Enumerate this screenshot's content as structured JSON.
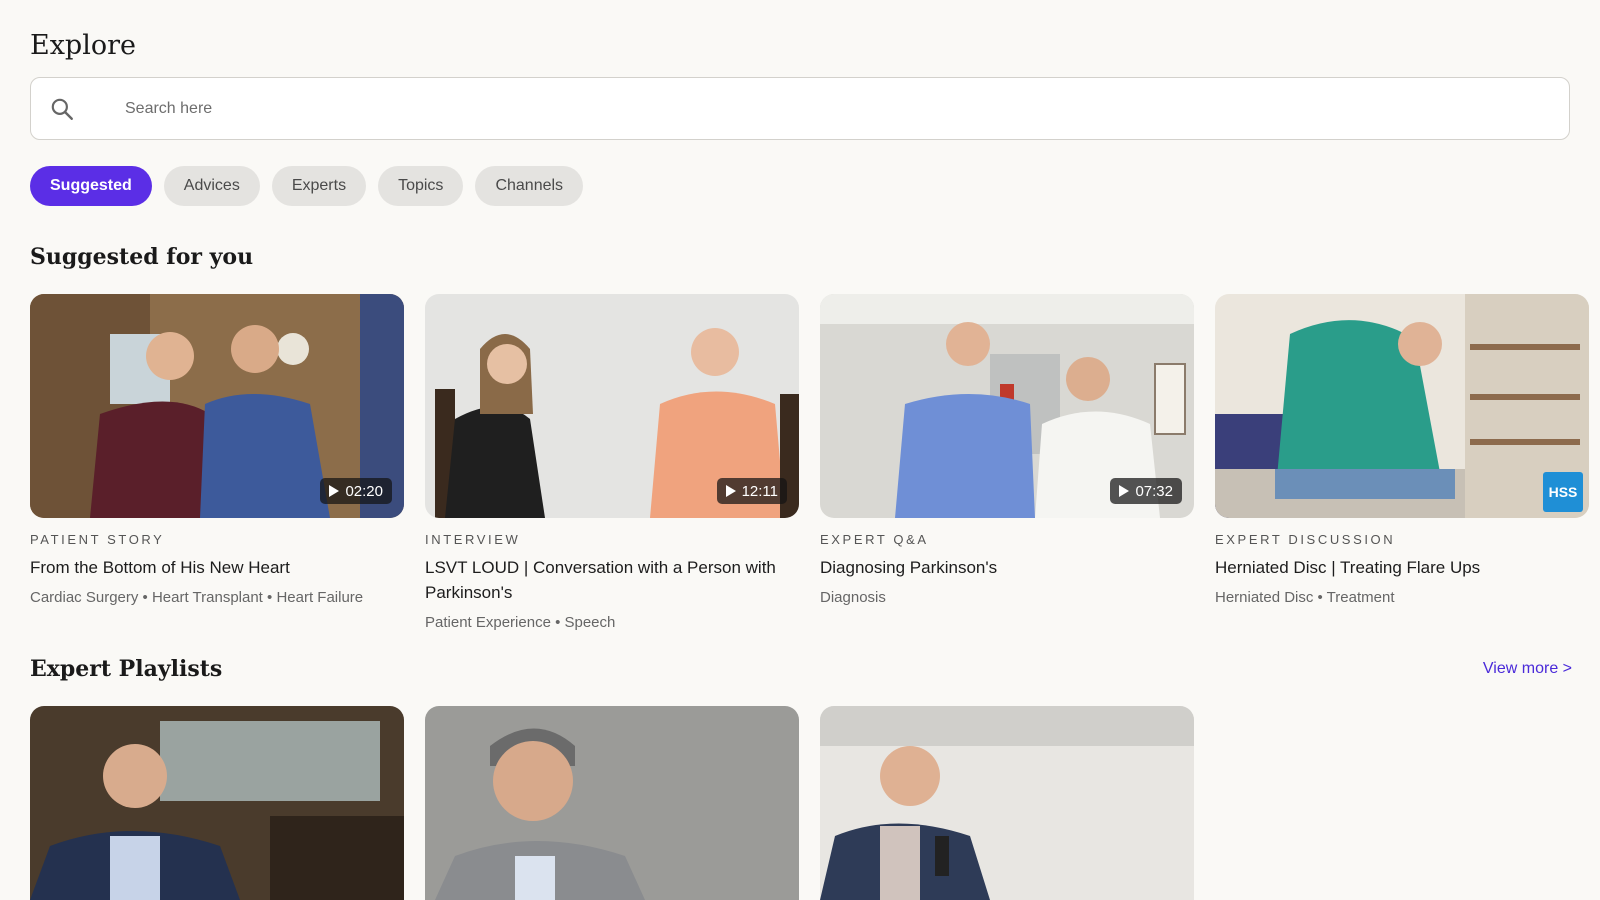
{
  "header": {
    "title": "Explore"
  },
  "search": {
    "placeholder": "Search here",
    "value": ""
  },
  "filters": [
    {
      "label": "Suggested",
      "active": true
    },
    {
      "label": "Advices",
      "active": false
    },
    {
      "label": "Experts",
      "active": false
    },
    {
      "label": "Topics",
      "active": false
    },
    {
      "label": "Channels",
      "active": false
    }
  ],
  "suggested": {
    "title": "Suggested for you",
    "videos": [
      {
        "category": "PATIENT STORY",
        "title": "From the Bottom of His New Heart",
        "tags": "Cardiac Surgery  • Heart Transplant • Heart Failure",
        "duration": "02:20"
      },
      {
        "category": "INTERVIEW",
        "title": "LSVT LOUD | Conversation with a Person with Parkinson's",
        "tags": "Patient Experience • Speech",
        "duration": "12:11"
      },
      {
        "category": "EXPERT Q&A",
        "title": "Diagnosing Parkinson's",
        "tags": "Diagnosis",
        "duration": "07:32"
      },
      {
        "category": "EXPERT DISCUSSION",
        "title": "Herniated Disc | Treating Flare Ups",
        "tags": "Herniated Disc • Treatment",
        "badge": "HSS"
      }
    ]
  },
  "playlists": {
    "title": "Expert Playlists",
    "view_more": "View more >"
  },
  "colors": {
    "accent": "#5b2ee6",
    "link": "#4a2ad9",
    "background": "#faf9f6",
    "badge": "#1f8fd6"
  }
}
